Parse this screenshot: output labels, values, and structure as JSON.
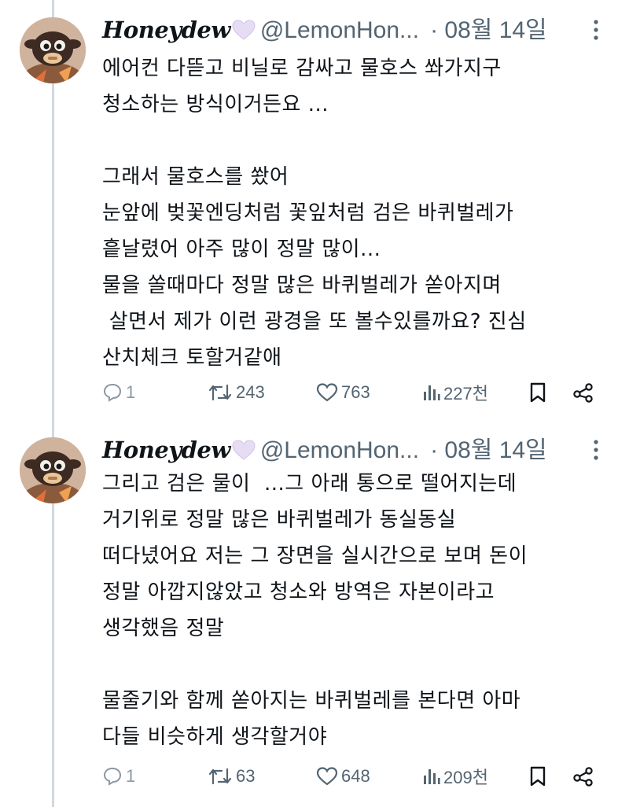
{
  "colors": {
    "text": "#0f1419",
    "secondary": "#536471",
    "thread_line": "#cfd9de",
    "heart_emoji": "#e6ddf5"
  },
  "tweets": [
    {
      "display_name": "Honeydew",
      "name_emoji": "🤍",
      "handle": "@LemonHon...",
      "date": "· 08월 14일",
      "lines": [
        "에어컨 다뜯고 비닐로 감싸고 물호스 쏴가지구",
        "청소하는 방식이거든요 ...",
        "",
        "그래서 물호스를 쐈어",
        "눈앞에 벚꽃엔딩처럼 꽃잎처럼 검은 바퀴벌레가",
        "흩날렸어 아주 많이 정말 많이...",
        "물을 쏠때마다 정말 많은 바퀴벌레가 쏟아지며",
        " 살면서 제가 이런 광경을 또 볼수있를까요? 진심",
        "산치체크 토할거같애"
      ],
      "replies": "1",
      "retweets": "243",
      "likes": "763",
      "views": "227천"
    },
    {
      "display_name": "Honeydew",
      "name_emoji": "🤍",
      "handle": "@LemonHon...",
      "date": "· 08월 14일",
      "lines": [
        "그리고 검은 물이  ...그 아래 통으로 떨어지는데",
        "거기위로 정말 많은 바퀴벌레가 동실동실",
        "떠다녔어요 저는 그 장면을 실시간으로 보며 돈이",
        "정말 아깝지않았고 청소와 방역은 자본이라고",
        "생각했음 정말",
        "",
        "물줄기와 함께 쏟아지는 바퀴벌레를 본다면 아마",
        "다들 비슷하게 생각할거야"
      ],
      "replies": "1",
      "retweets": "63",
      "likes": "648",
      "views": "209천"
    }
  ]
}
